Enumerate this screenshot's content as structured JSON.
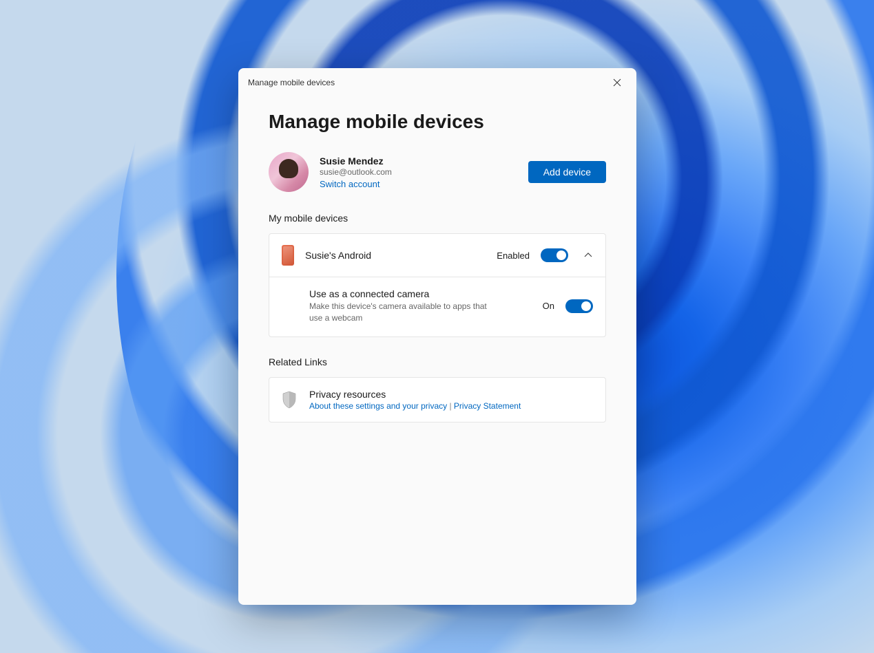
{
  "window": {
    "title": "Manage mobile devices"
  },
  "page": {
    "heading": "Manage mobile devices"
  },
  "user": {
    "name": "Susie Mendez",
    "email": "susie@outlook.com",
    "switch_label": "Switch account",
    "add_device_label": "Add device"
  },
  "devices": {
    "section_heading": "My mobile devices",
    "list": [
      {
        "name": "Susie's Android",
        "toggle_label": "Enabled",
        "toggle_on": true,
        "expanded": true,
        "settings": [
          {
            "title": "Use as a connected camera",
            "description": "Make this device's camera available to apps that use a webcam",
            "toggle_label": "On",
            "toggle_on": true
          }
        ]
      }
    ]
  },
  "related": {
    "section_heading": "Related Links",
    "privacy": {
      "title": "Privacy resources",
      "link1": "About these settings and your privacy",
      "separator": " | ",
      "link2": "Privacy Statement"
    }
  },
  "colors": {
    "accent": "#0067c0",
    "window_bg": "#fafafa",
    "card_bg": "#ffffff",
    "border": "#e5e5e5"
  }
}
